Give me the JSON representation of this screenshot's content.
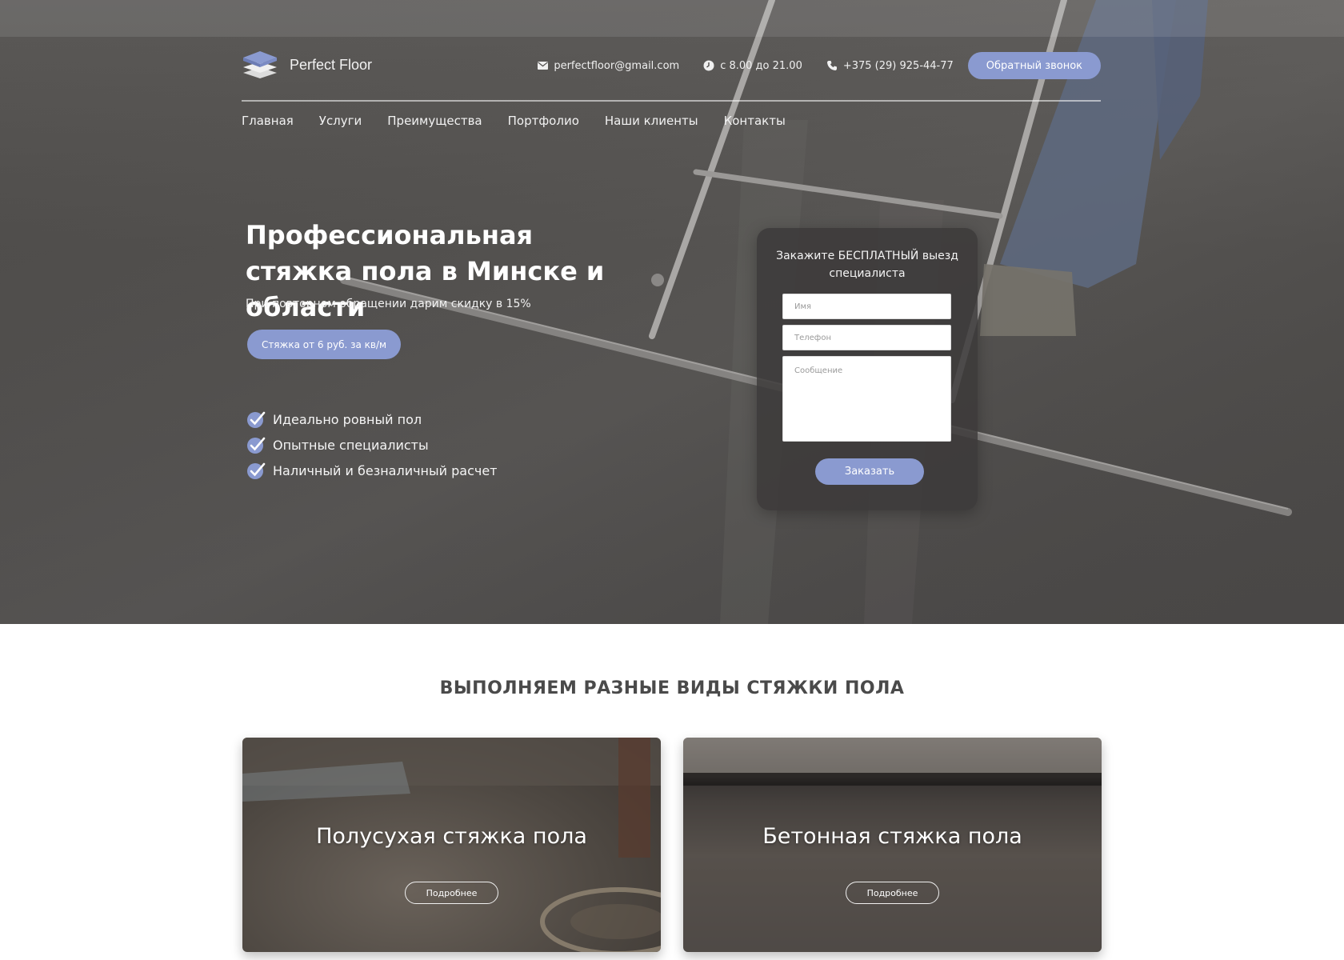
{
  "brand": {
    "name": "Perfect Floor",
    "logo_icon": "layers-icon"
  },
  "header": {
    "email": "perfectfloor@gmail.com",
    "hours": "с 8.00 до 21.00",
    "phone": "+375 (29) 925-44-77",
    "callback_label": "Обратный звонок"
  },
  "nav": {
    "items": [
      "Главная",
      "Услуги",
      "Преимущества",
      "Портфолио",
      "Наши клиенты",
      "Контакты"
    ]
  },
  "hero": {
    "title": "Профессиональная стяжка пола в Минске и области",
    "subtitle": "При повторном обращении дарим скидку в 15%",
    "price_label": "Стяжка от 6 руб. за кв/м",
    "features": [
      "Идеально ровный пол",
      "Опытные специалисты",
      "Наличный и безналичный расчет"
    ]
  },
  "form": {
    "title": "Закажите БЕСПЛАТНЫЙ выезд специалиста",
    "name_placeholder": "Имя",
    "phone_placeholder": "Телефон",
    "message_placeholder": "Сообщение",
    "submit_label": "Заказать"
  },
  "services": {
    "title": "ВЫПОЛНЯЕМ РАЗНЫЕ ВИДЫ СТЯЖКИ ПОЛА",
    "cards": [
      {
        "title": "Полусухая стяжка пола",
        "button": "Подробнее"
      },
      {
        "title": "Бетонная стяжка пола",
        "button": "Подробнее"
      }
    ]
  },
  "colors": {
    "accent": "#8a9ad0",
    "hero_overlay": "#4d4b49",
    "heading": "#4a4a4a"
  }
}
